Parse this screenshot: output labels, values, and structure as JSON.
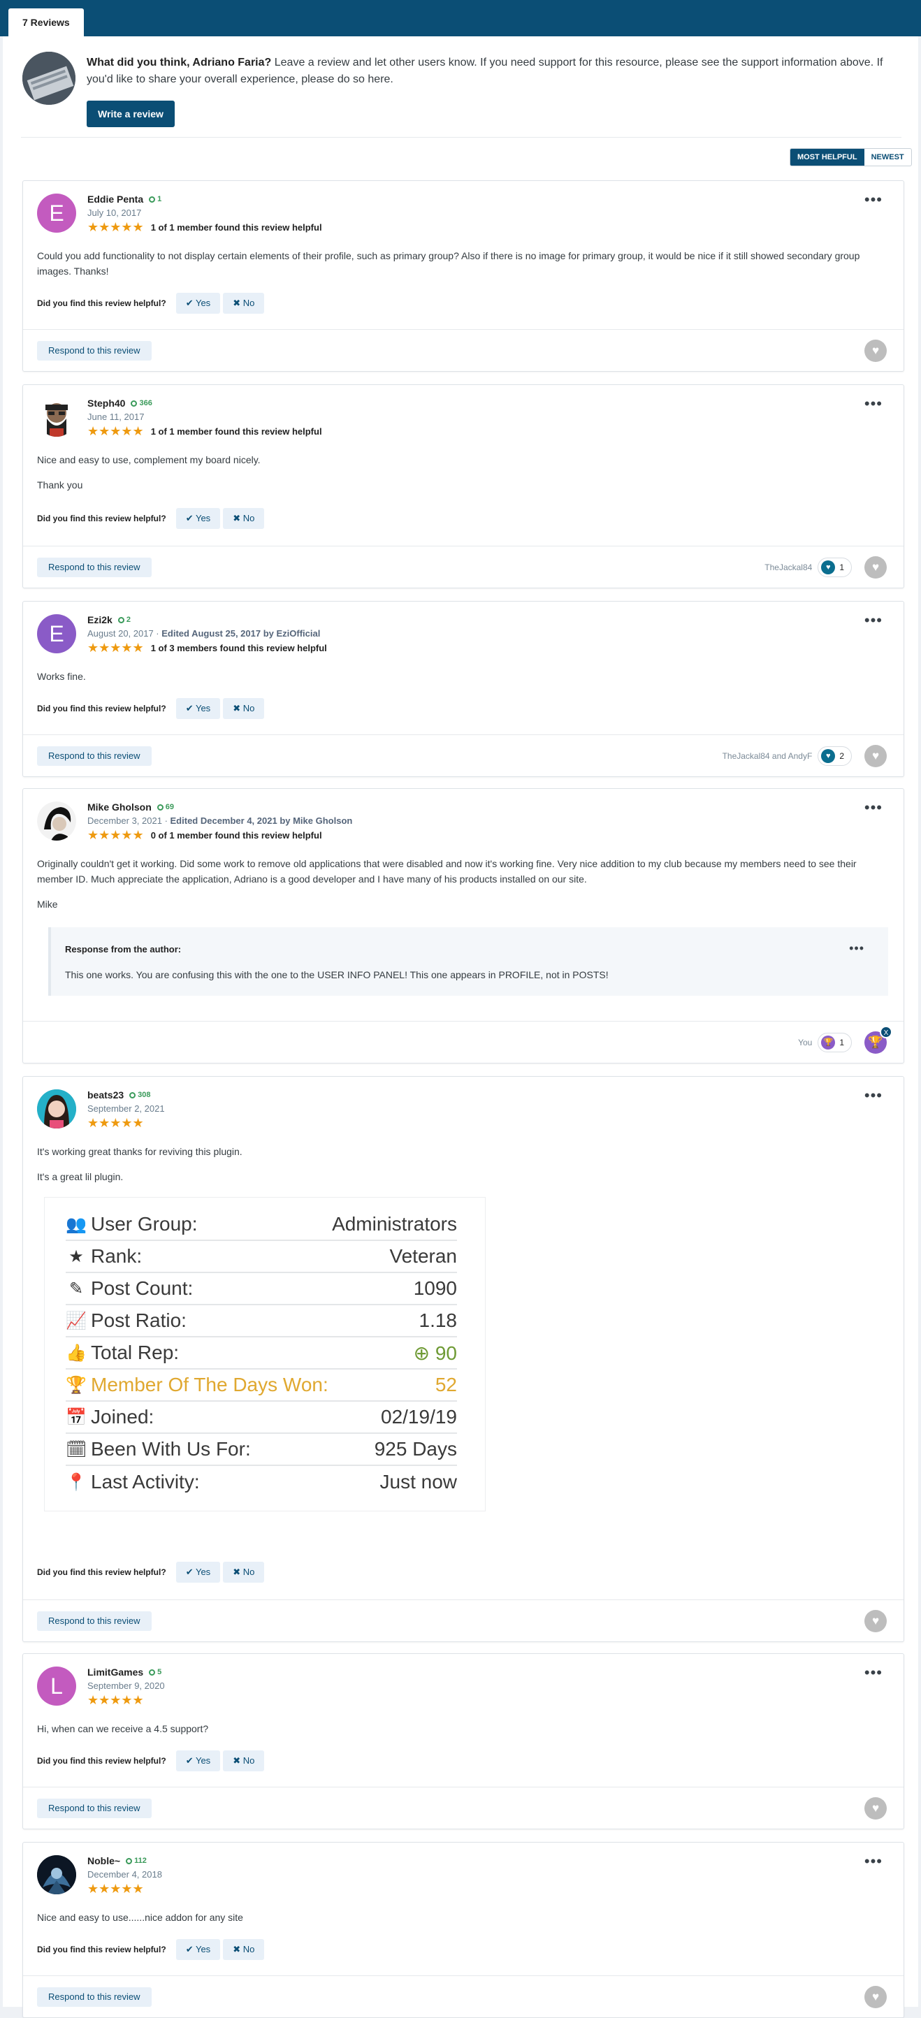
{
  "tab": {
    "label": "7 Reviews"
  },
  "intro": {
    "question": "What did you think, Adriano Faria?",
    "text": " Leave a review and let other users know. If you need support for this resource, please see the support information above. If you'd like to share your overall experience, please do so here.",
    "button": "Write a review"
  },
  "sort": {
    "most_helpful": "MOST HELPFUL",
    "newest": "NEWEST"
  },
  "common": {
    "helpful_question": "Did you find this review helpful?",
    "yes": "Yes",
    "no": "No",
    "respond": "Respond to this review",
    "stars": "★★★★★"
  },
  "reviews": [
    {
      "name": "Eddie Penta",
      "rep": "1",
      "avatar_letter": "E",
      "avatar_color": "#c35bbf",
      "date": "July 10, 2017",
      "helpful": "1 of 1 member found this review helpful",
      "body": [
        "Could you add functionality to not display certain elements of their profile, such as primary group? Also if there is no image for primary group, it would be nice if it still showed secondary group images. Thanks!"
      ]
    },
    {
      "name": "Steph40",
      "rep": "366",
      "date": "June 11, 2017",
      "helpful": "1 of 1 member found this review helpful",
      "body": [
        "Nice and easy to use, complement my board nicely.",
        "Thank you"
      ],
      "reactors": "TheJackal84",
      "reaction_count": "1"
    },
    {
      "name": "Ezi2k",
      "rep": "2",
      "avatar_letter": "E",
      "avatar_color": "#8a5bc7",
      "date": "August 20, 2017 · ",
      "edited": "Edited August 25, 2017 by EziOfficial",
      "helpful": "1 of 3 members found this review helpful",
      "body": [
        "Works fine."
      ],
      "reactors": "TheJackal84 and AndyF",
      "reaction_count": "2"
    },
    {
      "name": "Mike Gholson",
      "rep": "69",
      "date": "December 3, 2021 · ",
      "edited": "Edited December 4, 2021 by Mike Gholson",
      "helpful": "0 of 1 member found this review helpful",
      "body": [
        "Originally couldn't get it working.  Did some work to remove old applications that were disabled and now it's working fine.  Very nice addition to my club because my members need to see their member ID.  Much appreciate the application, Adriano is a good developer and I have many of his products installed on our site.",
        "Mike"
      ],
      "response_title": "Response from the author:",
      "response_text": "This one works. You are confusing this with the one to the USER INFO PANEL! This one appears in PROFILE, not in POSTS!",
      "reactors": "You",
      "reaction_count": "1",
      "badge_x": "X"
    },
    {
      "name": "beats23",
      "rep": "308",
      "date": "September 2, 2021",
      "body": [
        "It's working great thanks for reviving this plugin.",
        "It's a great lil plugin."
      ],
      "profile": [
        {
          "label": "User Group:",
          "value": "Administrators"
        },
        {
          "label": "Rank:",
          "value": "Veteran"
        },
        {
          "label": "Post Count:",
          "value": "1090"
        },
        {
          "label": "Post Ratio:",
          "value": "1.18"
        },
        {
          "label": "Total Rep:",
          "value": "90"
        },
        {
          "label": "Member Of The Days Won:",
          "value": "52"
        },
        {
          "label": "Joined:",
          "value": "02/19/19"
        },
        {
          "label": "Been With Us For:",
          "value": "925 Days"
        },
        {
          "label": "Last Activity:",
          "value": "Just now"
        }
      ]
    },
    {
      "name": "LimitGames",
      "rep": "5",
      "avatar_letter": "L",
      "avatar_color": "#c35bbf",
      "date": "September 9, 2020",
      "body": [
        "Hi, when can we receive a 4.5 support?"
      ]
    },
    {
      "name": "Noble~",
      "rep": "112",
      "date": "December 4, 2018",
      "body": [
        "Nice and easy to use......nice addon for any site"
      ]
    }
  ],
  "colors": {
    "brand": "#0b4e75",
    "star": "#ee9a10",
    "rep": "#3a9a5a"
  }
}
